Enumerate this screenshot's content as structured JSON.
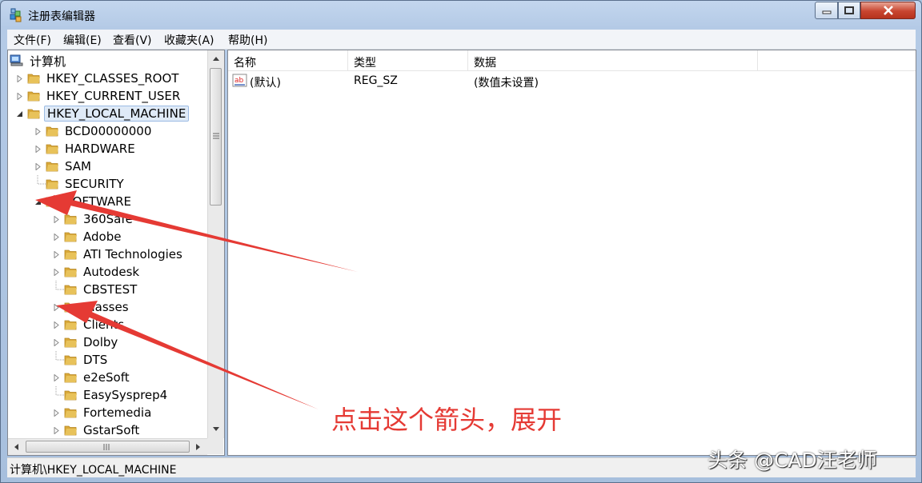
{
  "window": {
    "title": "注册表编辑器"
  },
  "menu": [
    "文件(F)",
    "编辑(E)",
    "查看(V)",
    "收藏夹(A)",
    "帮助(H)"
  ],
  "tree": {
    "root": "计算机",
    "items": [
      {
        "label": "HKEY_CLASSES_ROOT",
        "level": 1,
        "expander": "collapsed"
      },
      {
        "label": "HKEY_CURRENT_USER",
        "level": 1,
        "expander": "collapsed"
      },
      {
        "label": "HKEY_LOCAL_MACHINE",
        "level": 1,
        "expander": "expanded",
        "selected": true
      },
      {
        "label": "BCD00000000",
        "level": 2,
        "expander": "collapsed"
      },
      {
        "label": "HARDWARE",
        "level": 2,
        "expander": "collapsed"
      },
      {
        "label": "SAM",
        "level": 2,
        "expander": "collapsed"
      },
      {
        "label": "SECURITY",
        "level": 2,
        "expander": "none"
      },
      {
        "label": "SOFTWARE",
        "level": 2,
        "expander": "expanded"
      },
      {
        "label": "360Safe",
        "level": 3,
        "expander": "collapsed"
      },
      {
        "label": "Adobe",
        "level": 3,
        "expander": "collapsed"
      },
      {
        "label": "ATI Technologies",
        "level": 3,
        "expander": "collapsed"
      },
      {
        "label": "Autodesk",
        "level": 3,
        "expander": "collapsed"
      },
      {
        "label": "CBSTEST",
        "level": 3,
        "expander": "none"
      },
      {
        "label": "Classes",
        "level": 3,
        "expander": "collapsed"
      },
      {
        "label": "Clients",
        "level": 3,
        "expander": "collapsed"
      },
      {
        "label": "Dolby",
        "level": 3,
        "expander": "collapsed"
      },
      {
        "label": "DTS",
        "level": 3,
        "expander": "none"
      },
      {
        "label": "e2eSoft",
        "level": 3,
        "expander": "collapsed"
      },
      {
        "label": "EasySysprep4",
        "level": 3,
        "expander": "none"
      },
      {
        "label": "Fortemedia",
        "level": 3,
        "expander": "collapsed"
      },
      {
        "label": "GstarSoft",
        "level": 3,
        "expander": "collapsed"
      }
    ]
  },
  "list": {
    "columns": [
      "名称",
      "类型",
      "数据"
    ],
    "rows": [
      {
        "name": "(默认)",
        "type": "REG_SZ",
        "data": "(数值未设置)"
      }
    ]
  },
  "status": "计算机\\HKEY_LOCAL_MACHINE",
  "annotation": "点击这个箭头，展开",
  "watermark": "头条 @CAD汪老师",
  "colors": {
    "arrow": "#e53a34",
    "folder": "#e8c25a",
    "selection": "#dfeaf7"
  }
}
